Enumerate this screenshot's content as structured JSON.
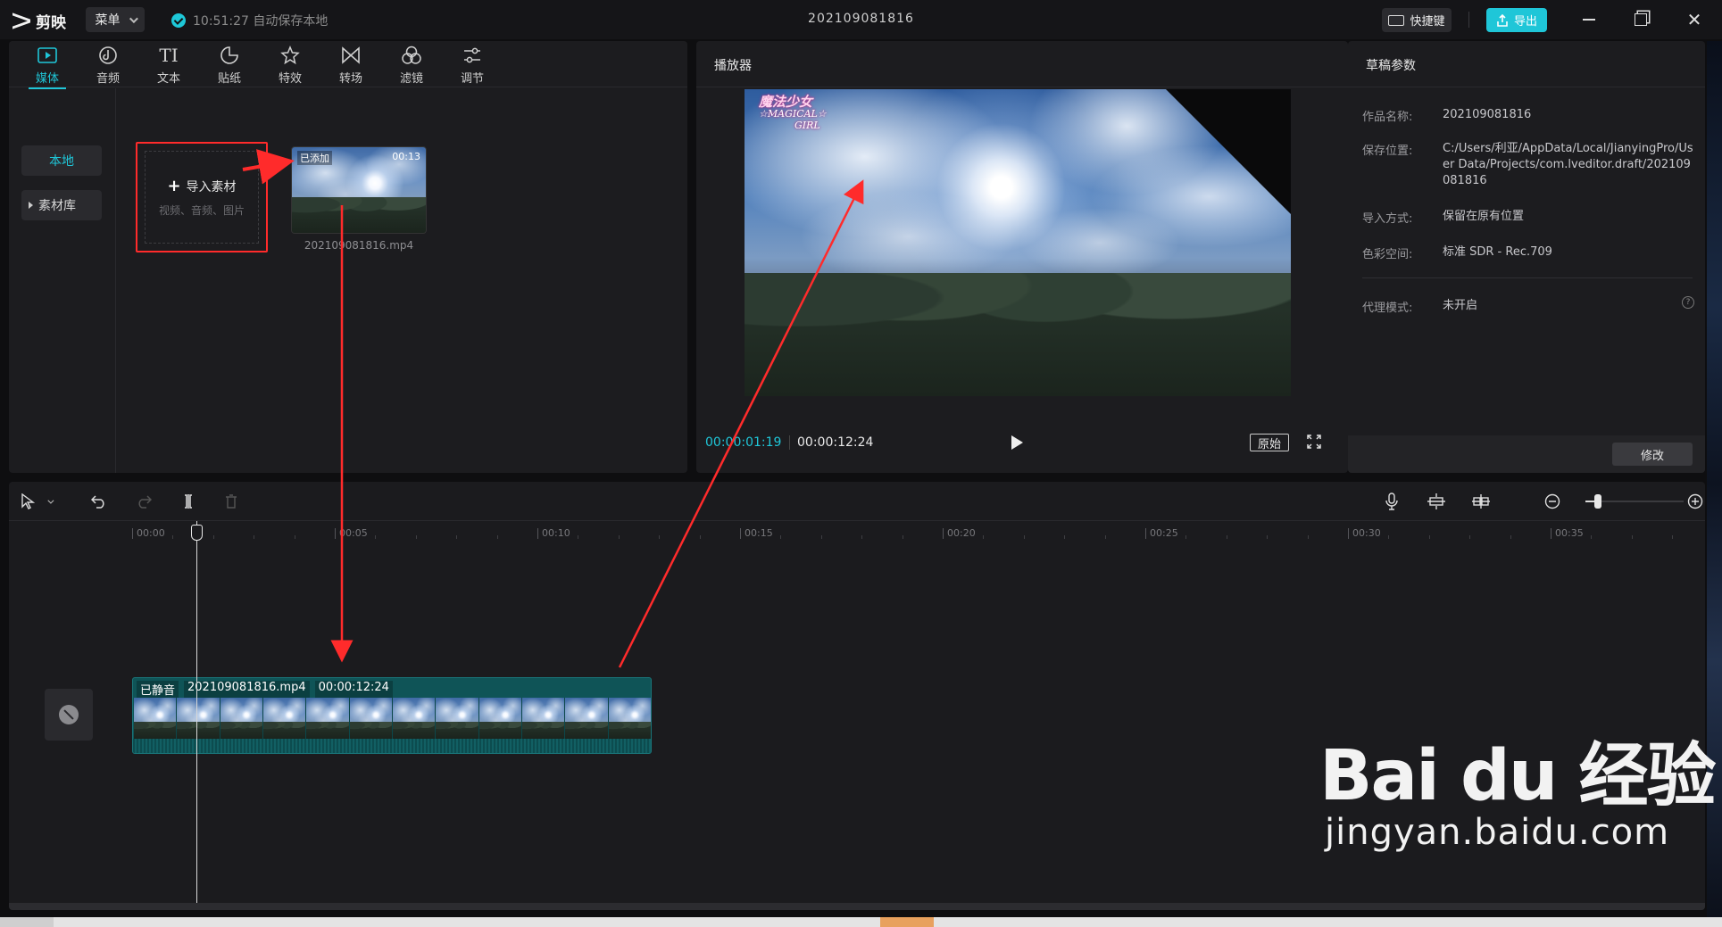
{
  "app": {
    "name": "剪映",
    "menu_label": "菜单",
    "autosave": "10:51:27 自动保存本地",
    "project_title": "202109081816",
    "shortcut_label": "快捷键",
    "export_label": "导出"
  },
  "media_tools": [
    {
      "label": "媒体",
      "icon": "media-icon",
      "active": true
    },
    {
      "label": "音频",
      "icon": "audio-icon",
      "active": false
    },
    {
      "label": "文本",
      "icon": "text-icon",
      "active": false
    },
    {
      "label": "贴纸",
      "icon": "sticker-icon",
      "active": false
    },
    {
      "label": "特效",
      "icon": "effects-icon",
      "active": false
    },
    {
      "label": "转场",
      "icon": "transition-icon",
      "active": false
    },
    {
      "label": "滤镜",
      "icon": "filter-icon",
      "active": false
    },
    {
      "label": "调节",
      "icon": "adjust-icon",
      "active": false
    }
  ],
  "media_side": {
    "local": "本地",
    "library": "素材库"
  },
  "import": {
    "title": "导入素材",
    "subtitle": "视频、音频、图片"
  },
  "clip_thumb": {
    "added": "已添加",
    "duration": "00:13",
    "filename": "202109081816.mp4"
  },
  "player": {
    "title": "播放器",
    "overlay_line1": "魔法少女",
    "overlay_line2": "☆MAGICAL☆",
    "overlay_line3": "GIRL",
    "current_time": "00:00:01:19",
    "total_time": "00:00:12:24",
    "original_label": "原始"
  },
  "props": {
    "title": "草稿参数",
    "rows": [
      {
        "label": "作品名称:",
        "value": "202109081816"
      },
      {
        "label": "保存位置:",
        "value": "C:/Users/利亚/AppData/Local/JianyingPro/User Data/Projects/com.lveditor.draft/202109081816"
      },
      {
        "label": "导入方式:",
        "value": "保留在原有位置"
      },
      {
        "label": "色彩空间:",
        "value": "标准 SDR - Rec.709"
      },
      {
        "label": "代理模式:",
        "value": "未开启"
      }
    ],
    "modify_label": "修改"
  },
  "timeline": {
    "ticks": [
      "00:00",
      "00:05",
      "00:10",
      "00:15",
      "00:20",
      "00:25",
      "00:30",
      "00:35"
    ],
    "clip": {
      "muted": "已静音",
      "filename": "202109081816.mp4",
      "duration": "00:00:12:24"
    }
  },
  "watermark": {
    "main": "Bai du 经验",
    "sub": "jingyan.baidu.com"
  },
  "colors": {
    "accent": "#1fc6d8",
    "annotation_red": "#ff2b2b",
    "clip_teal": "#0f5457"
  }
}
